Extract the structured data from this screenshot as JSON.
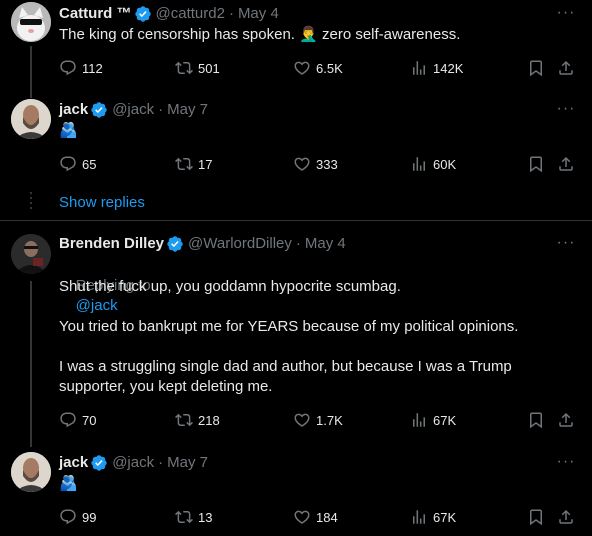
{
  "tweets": [
    {
      "name": "Catturd ™",
      "handle": "@catturd2",
      "date": "May 4",
      "text": "The king of censorship has spoken. 🤦‍♂️ zero self-awareness.",
      "replies": "112",
      "retweets": "501",
      "likes": "6.5K",
      "views": "142K"
    },
    {
      "name": "jack",
      "handle": "@jack",
      "date": "May 7",
      "text": "🫂",
      "replies": "65",
      "retweets": "17",
      "likes": "333",
      "views": "60K"
    },
    {
      "name": "Brenden Dilley",
      "handle": "@WarlordDilley",
      "date": "May 4",
      "replying_label": "Replying to",
      "replying_to": "@jack",
      "text": "Shut the fuck up, you goddamn hypocrite scumbag.\n\nYou tried to bankrupt me for YEARS because of my political opinions.\n\nI was a struggling single dad and author, but because I was a Trump supporter, you kept deleting me.",
      "replies": "70",
      "retweets": "218",
      "likes": "1.7K",
      "views": "67K"
    },
    {
      "name": "jack",
      "handle": "@jack",
      "date": "May 7",
      "text": "🫂",
      "replies": "99",
      "retweets": "13",
      "likes": "184",
      "views": "67K"
    }
  ],
  "show_replies": "Show replies",
  "colors": {
    "background": "#000000",
    "accent": "#1d9bf0",
    "muted": "#71767b",
    "text": "#e7e9ea"
  },
  "icons": [
    "reply-icon",
    "retweet-icon",
    "like-icon",
    "views-icon",
    "bookmark-icon",
    "share-icon",
    "verified-icon",
    "more-icon"
  ]
}
